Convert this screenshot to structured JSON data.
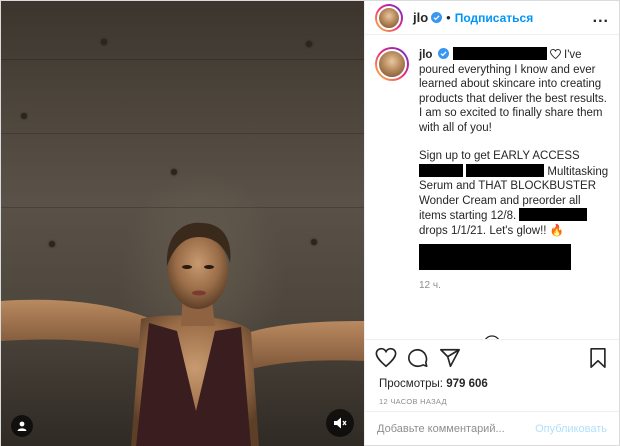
{
  "header": {
    "username": "jlo",
    "follow_label": "Подписаться",
    "dot": "•",
    "more": "..."
  },
  "caption": {
    "username": "jlo",
    "text_1": "I've poured everything I know and ever learned about skincare into creating products that deliver the best results. I am so excited to finally share them with all of you!",
    "text_2a": "Sign up to get EARLY ACCESS",
    "text_2b": "Multitasking Serum and THAT BLOCKBUSTER Wonder Cream and preorder all items starting 12/8.",
    "text_2c": "drops 1/1/21. Let's glow!!",
    "emoji": "🔥",
    "time": "12 ч."
  },
  "stats": {
    "views_label": "Просмотры:",
    "views_value": "979 606",
    "timestamp": "12 ЧАСОВ НАЗАД"
  },
  "comment_box": {
    "placeholder": "Добавьте комментарий...",
    "publish_label": "Опубликовать"
  },
  "icons": {
    "like": "heart-icon",
    "comment": "comment-icon",
    "share": "share-icon",
    "save": "bookmark-icon",
    "mute": "sound-off-icon",
    "add": "add-circle-icon"
  },
  "colors": {
    "accent": "#0095f6",
    "publish_disabled": "#b2dffc",
    "muted_text": "#8e8e8e"
  }
}
